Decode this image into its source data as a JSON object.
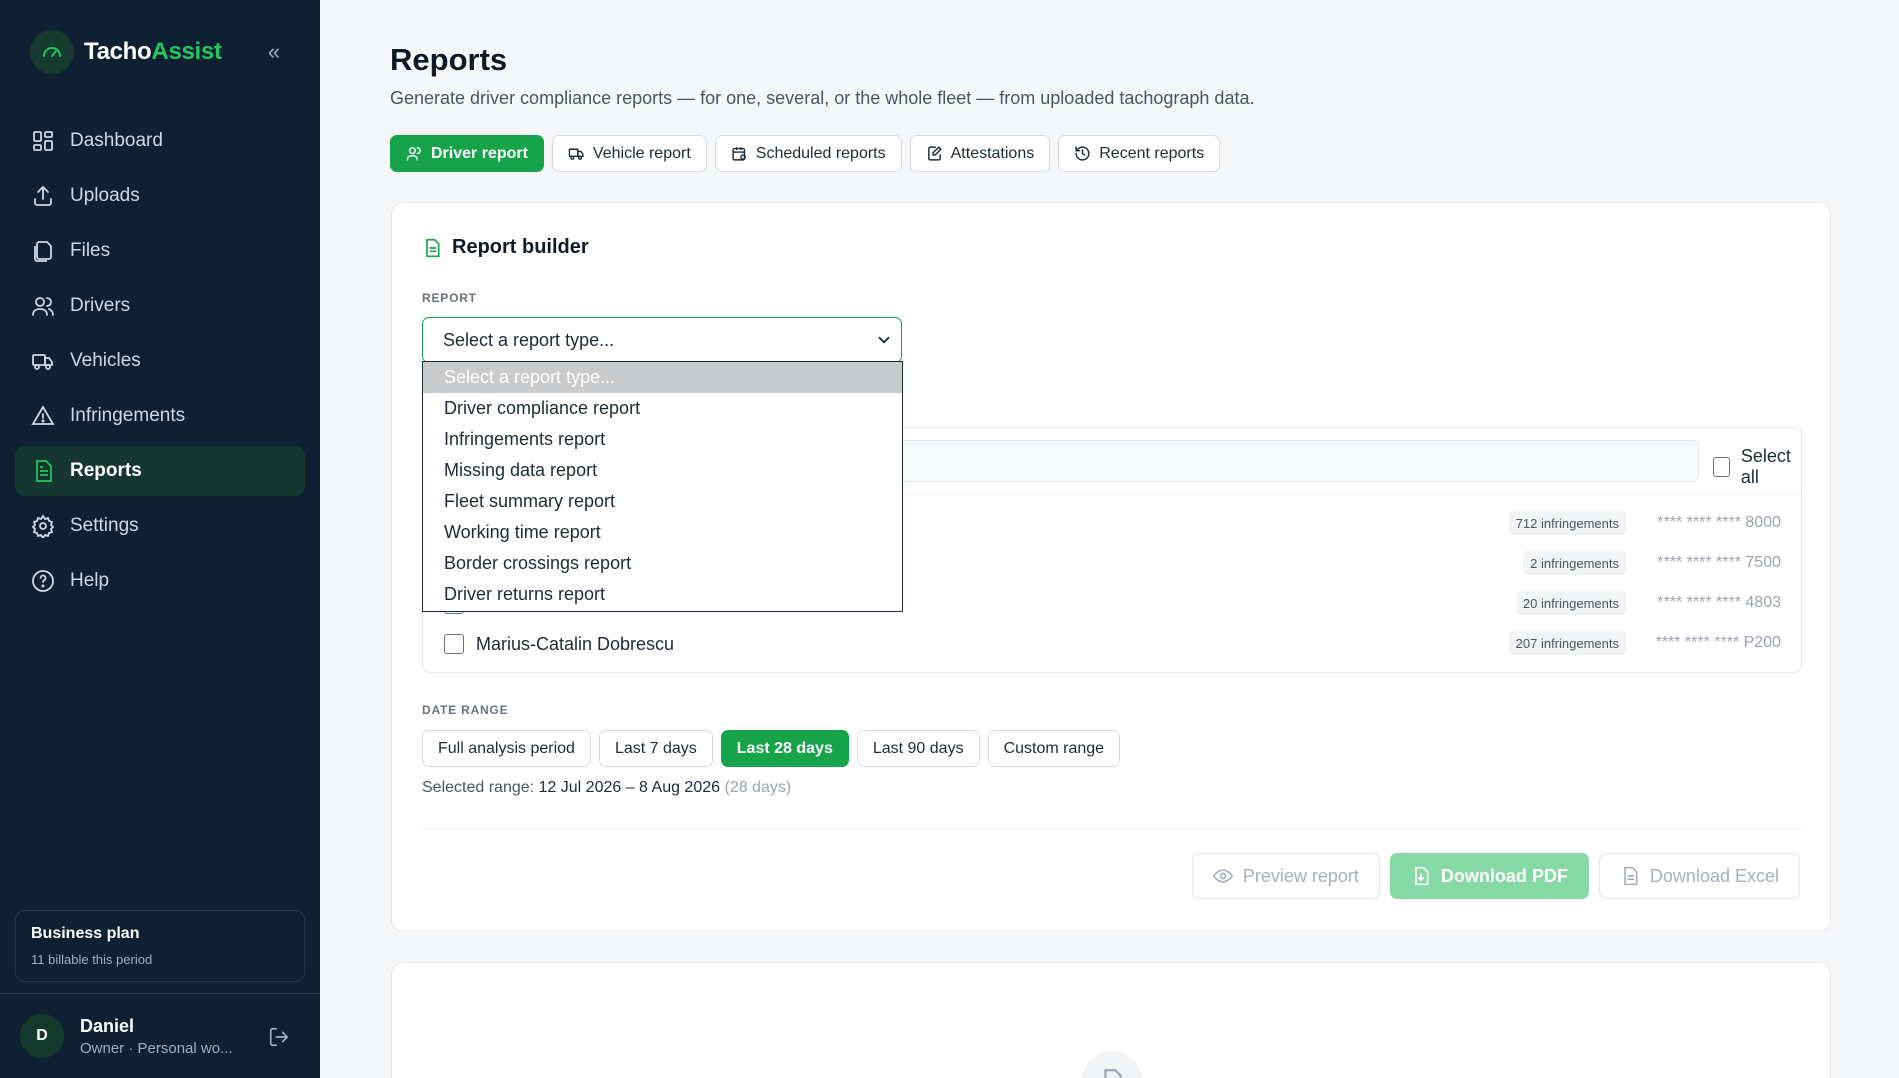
{
  "brand": {
    "name_part1": "Tacho",
    "name_part2": "Assist"
  },
  "sidebar": {
    "collapse_glyph": "«",
    "items": [
      {
        "label": "Dashboard",
        "icon": "dashboard-icon"
      },
      {
        "label": "Uploads",
        "icon": "upload-icon"
      },
      {
        "label": "Files",
        "icon": "files-icon"
      },
      {
        "label": "Drivers",
        "icon": "users-icon"
      },
      {
        "label": "Vehicles",
        "icon": "truck-icon"
      },
      {
        "label": "Infringements",
        "icon": "warning-icon"
      },
      {
        "label": "Reports",
        "icon": "report-icon",
        "active": true
      },
      {
        "label": "Settings",
        "icon": "gear-icon"
      },
      {
        "label": "Help",
        "icon": "help-icon"
      }
    ],
    "plan": {
      "title": "Business plan",
      "subtitle": "11 billable this period"
    },
    "user": {
      "initial": "D",
      "name": "Daniel",
      "role": "Owner · Personal wo..."
    }
  },
  "page": {
    "title": "Reports",
    "subtitle": "Generate driver compliance reports — for one, several, or the whole fleet — from uploaded tachograph data."
  },
  "tabs": [
    {
      "label": "Driver report",
      "active": true
    },
    {
      "label": "Vehicle report"
    },
    {
      "label": "Scheduled reports"
    },
    {
      "label": "Attestations"
    },
    {
      "label": "Recent reports"
    }
  ],
  "builder": {
    "title": "Report builder",
    "report_label": "REPORT",
    "select_value": "Select a report type...",
    "options": [
      "Select a report type...",
      "Driver compliance report",
      "Infringements report",
      "Missing data report",
      "Fleet summary report",
      "Working time report",
      "Border crossings report",
      "Driver returns report"
    ],
    "select_all_label": "Select all",
    "drivers": [
      {
        "name": "",
        "infringements": "712 infringements",
        "card": "**** **** **** 8000"
      },
      {
        "name": "",
        "infringements": "2 infringements",
        "card": "**** **** **** 7500"
      },
      {
        "name": "",
        "infringements": "20 infringements",
        "card": "**** **** **** 4803"
      },
      {
        "name": "Marius-Catalin Dobrescu",
        "infringements": "207 infringements",
        "card": "**** **** **** P200"
      }
    ],
    "date_range_label": "DATE RANGE",
    "date_options": [
      {
        "label": "Full analysis period"
      },
      {
        "label": "Last 7 days"
      },
      {
        "label": "Last 28 days",
        "active": true
      },
      {
        "label": "Last 90 days"
      },
      {
        "label": "Custom range"
      }
    ],
    "selected_range_prefix": "Selected range:",
    "selected_range_value": "12 Jul 2026 – 8 Aug 2026",
    "selected_range_days": "(28 days)",
    "actions": {
      "preview": "Preview report",
      "pdf": "Download PDF",
      "excel": "Download Excel"
    }
  },
  "colors": {
    "accent": "#16a34a",
    "sidebar_bg": "#0f2033",
    "accent_disabled": "#86d9a4"
  }
}
